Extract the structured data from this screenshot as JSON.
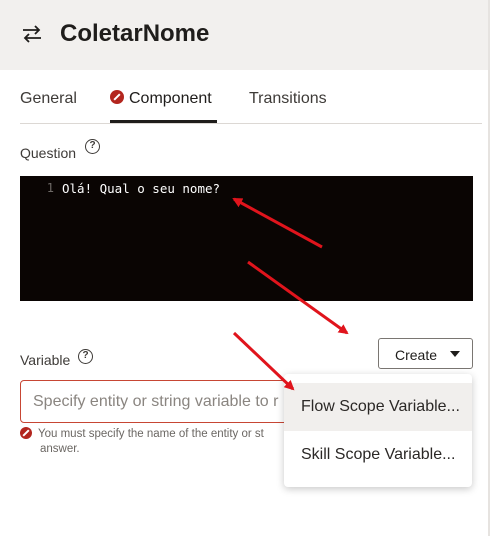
{
  "header": {
    "title": "ColetarNome",
    "icon": "swap-arrows-icon"
  },
  "tabs": [
    {
      "label": "General"
    },
    {
      "label": "Component",
      "status_icon": "error-icon",
      "active": true
    },
    {
      "label": "Transitions"
    }
  ],
  "question": {
    "label": "Question",
    "help_icon": "help-icon",
    "line_number": "1",
    "code": "Olá! Qual o seu nome?"
  },
  "variable": {
    "label": "Variable",
    "help_icon": "help-icon",
    "placeholder": "Specify entity or string variable to r",
    "error_line1": "You must specify the name of the entity or st",
    "error_line2": "answer."
  },
  "create_button": {
    "label": "Create",
    "icon": "caret-down-icon"
  },
  "menu": {
    "items": [
      {
        "label": "Flow Scope Variable...",
        "highlighted": true
      },
      {
        "label": "Skill Scope Variable..."
      }
    ]
  },
  "colors": {
    "header_bg": "#f2f0ee",
    "editor_bg": "#0a0503",
    "error": "#b3261e",
    "annotation_arrow": "#e0141c"
  }
}
